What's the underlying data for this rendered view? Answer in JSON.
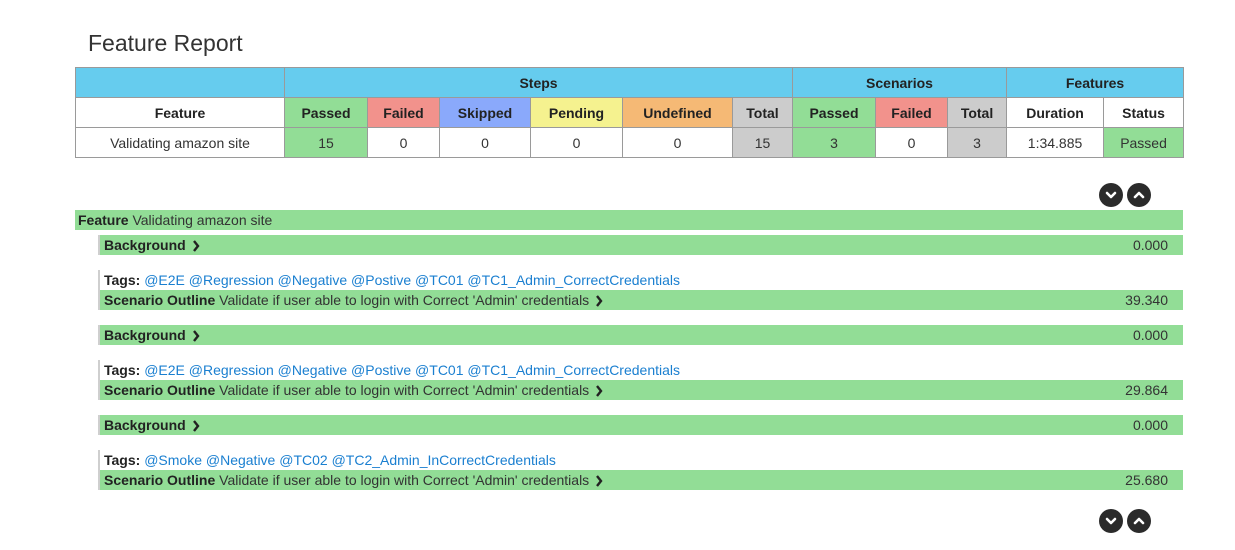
{
  "title": "Feature Report",
  "table": {
    "group_headers": [
      "Steps",
      "Scenarios",
      "Features"
    ],
    "columns": {
      "feature": "Feature",
      "passed": "Passed",
      "failed": "Failed",
      "skipped": "Skipped",
      "pending": "Pending",
      "undefined": "Undefined",
      "total": "Total",
      "sc_passed": "Passed",
      "sc_failed": "Failed",
      "sc_total": "Total",
      "duration": "Duration",
      "status": "Status"
    },
    "row": {
      "feature": "Validating amazon site",
      "passed": "15",
      "failed": "0",
      "skipped": "0",
      "pending": "0",
      "undefined": "0",
      "total": "15",
      "sc_passed": "3",
      "sc_failed": "0",
      "sc_total": "3",
      "duration": "1:34.885",
      "status": "Passed"
    }
  },
  "details": {
    "feature_keyword": "Feature",
    "feature_name": "Validating amazon site",
    "tags_keyword": "Tags:",
    "background_keyword": "Background",
    "scenario_outline_keyword": "Scenario Outline",
    "elements": [
      {
        "background_duration": "0.000",
        "tags": "@E2E @Regression @Negative @Postive @TC01 @TC1_Admin_CorrectCredentials",
        "scenario_name": "Validate if user able to login with Correct 'Admin' credentials",
        "scenario_duration": "39.340"
      },
      {
        "background_duration": "0.000",
        "tags": "@E2E @Regression @Negative @Postive @TC01 @TC1_Admin_CorrectCredentials",
        "scenario_name": "Validate if user able to login with Correct 'Admin' credentials",
        "scenario_duration": "29.864"
      },
      {
        "background_duration": "0.000",
        "tags": "@Smoke @Negative @TC02 @TC2_Admin_InCorrectCredentials",
        "scenario_name": "Validate if user able to login with Correct 'Admin' credentials",
        "scenario_duration": "25.680"
      }
    ]
  },
  "icons": {
    "expand": "chevron-down-circle-icon",
    "collapse": "chevron-up-circle-icon",
    "toggle": "chevron-right-icon"
  },
  "colors": {
    "passed": "#92dd96",
    "failed": "#f2928c",
    "skipped": "#8aa9fb",
    "pending": "#f5f28f",
    "undefined": "#f5b975",
    "total": "#cccccc",
    "header": "#66ccee",
    "tag": "#1a7fd0"
  }
}
